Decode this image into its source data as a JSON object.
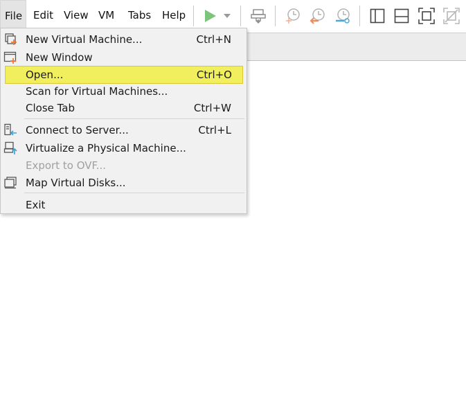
{
  "menubar": {
    "items": [
      {
        "label": "File"
      },
      {
        "label": "Edit"
      },
      {
        "label": "View"
      },
      {
        "label": "VM"
      },
      {
        "label": "Tabs"
      },
      {
        "label": "Help"
      }
    ]
  },
  "toolbar": {
    "icons": [
      "power-on-icon",
      "dropdown-arrow-icon",
      "send-ctrl-alt-del-icon",
      "take-snapshot-icon",
      "revert-snapshot-icon",
      "manage-snapshots-icon",
      "show-library-icon",
      "show-thumbnail-bar-icon",
      "full-screen-icon",
      "unity-icon"
    ]
  },
  "file_menu": {
    "items": [
      {
        "label": "New Virtual Machine...",
        "shortcut": "Ctrl+N",
        "icon": "new-vm-icon"
      },
      {
        "label": "New Window",
        "shortcut": "",
        "icon": "new-window-icon"
      },
      {
        "label": "Open...",
        "shortcut": "Ctrl+O",
        "icon": "",
        "highlighted": true
      },
      {
        "label": "Scan for Virtual Machines...",
        "shortcut": "",
        "icon": ""
      },
      {
        "label": "Close Tab",
        "shortcut": "Ctrl+W",
        "icon": ""
      },
      {
        "label": "Connect to Server...",
        "shortcut": "Ctrl+L",
        "icon": "connect-server-icon"
      },
      {
        "label": "Virtualize a Physical Machine...",
        "shortcut": "",
        "icon": "virtualize-physical-icon"
      },
      {
        "label": "Export to OVF...",
        "shortcut": "",
        "icon": "",
        "disabled": true
      },
      {
        "label": "Map Virtual Disks...",
        "shortcut": "",
        "icon": "map-disks-icon"
      },
      {
        "label": "Exit",
        "shortcut": "",
        "icon": ""
      }
    ]
  },
  "colors": {
    "highlight": "#f2ef5e",
    "play_green": "#7cc57a",
    "snapshot_orange": "#f08c5c",
    "snapshot_blue": "#4aa9d6"
  }
}
